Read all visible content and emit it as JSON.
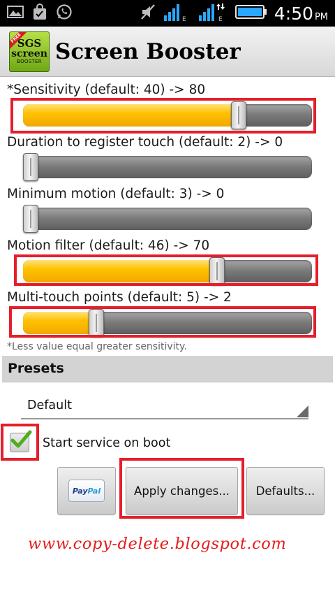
{
  "status_bar": {
    "time": "4:50",
    "ampm": "PM",
    "icons": [
      "gallery-icon",
      "shopping-bag-icon",
      "whatsapp-icon",
      "mute-icon",
      "signal-e-icon",
      "signal-e-data-icon",
      "battery-icon"
    ],
    "network_letter_1": "E",
    "network_letter_2": "E"
  },
  "app": {
    "title": "Screen Booster",
    "logo": {
      "line1": "SGS",
      "line2": "screen",
      "line3": "BOOSTER",
      "ribbon": "FREE"
    }
  },
  "settings": [
    {
      "label": "*Sensitivity (default: 40) -> 80",
      "value_fraction": 0.76,
      "highlighted": true
    },
    {
      "label": "Duration to register touch (default: 2) -> 0",
      "value_fraction": 0.0,
      "highlighted": false
    },
    {
      "label": "Minimum motion (default: 3) -> 0",
      "value_fraction": 0.0,
      "highlighted": false
    },
    {
      "label": "Motion filter (default: 46) -> 70",
      "value_fraction": 0.68,
      "highlighted": true
    },
    {
      "label": "Multi-touch points (default: 5) -> 2",
      "value_fraction": 0.24,
      "highlighted": true
    }
  ],
  "note": "*Less value equal greater sensitivity.",
  "presets": {
    "header": "Presets",
    "selected": "Default"
  },
  "boot_checkbox": {
    "label": "Start service on boot",
    "checked": true
  },
  "buttons": {
    "paypal_pay": "Pay",
    "paypal_pal": "Pal",
    "apply": "Apply changes...",
    "defaults": "Defaults..."
  },
  "watermark": "www.copy-delete.blogspot.com",
  "colors": {
    "accent_fill": "#ffc100",
    "highlight": "#e41f2b",
    "watermark": "#e51c1c"
  }
}
